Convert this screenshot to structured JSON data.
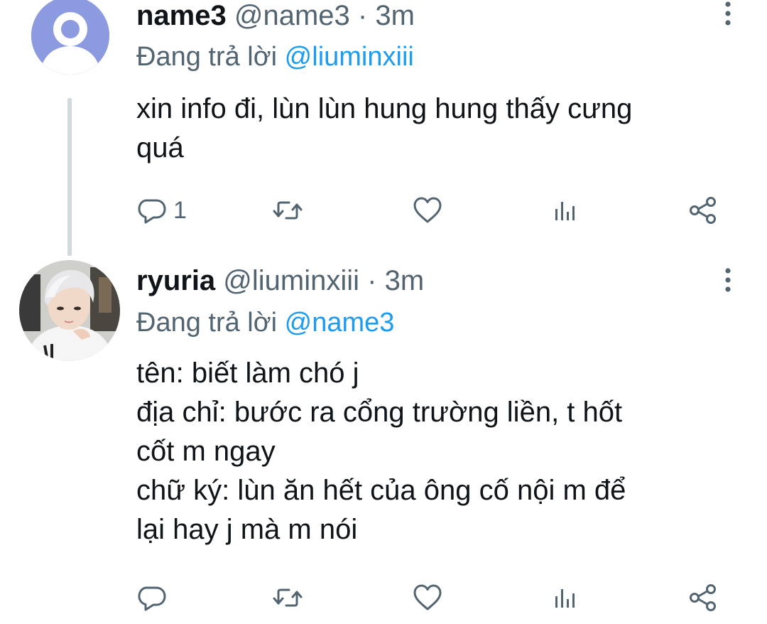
{
  "tweets": [
    {
      "display_name": "name3",
      "handle": "@name3",
      "separator": "·",
      "time": "3m",
      "replying_prefix": "Đang trả lời",
      "replying_to": "@liuminxiii",
      "text": "xin info đi, lùn lùn hung hung thấy cưng\nquá",
      "reply_count": "1",
      "avatar": "default-user-icon"
    },
    {
      "display_name": "ryuria",
      "handle": "@liuminxiii",
      "separator": "·",
      "time": "3m",
      "replying_prefix": "Đang trả lời",
      "replying_to": "@name3",
      "text": "tên: biết làm chó j\nđịa chỉ: bước ra cổng trường liền, t hốt\ncốt m ngay\nchữ ký: lùn ăn hết của ông cố nội m để\nlại hay j mà m nói",
      "reply_count": "",
      "avatar": "user-photo"
    }
  ],
  "icons": {
    "reply": "reply-icon",
    "retweet": "retweet-icon",
    "like": "heart-icon",
    "views": "views-icon",
    "share": "share-icon",
    "more": "more-vertical-icon"
  },
  "colors": {
    "text_primary": "#0f1419",
    "text_secondary": "#536471",
    "link": "#1d9bf0",
    "thread_line": "#cfd9de",
    "default_avatar_bg": "#8c9be0"
  }
}
